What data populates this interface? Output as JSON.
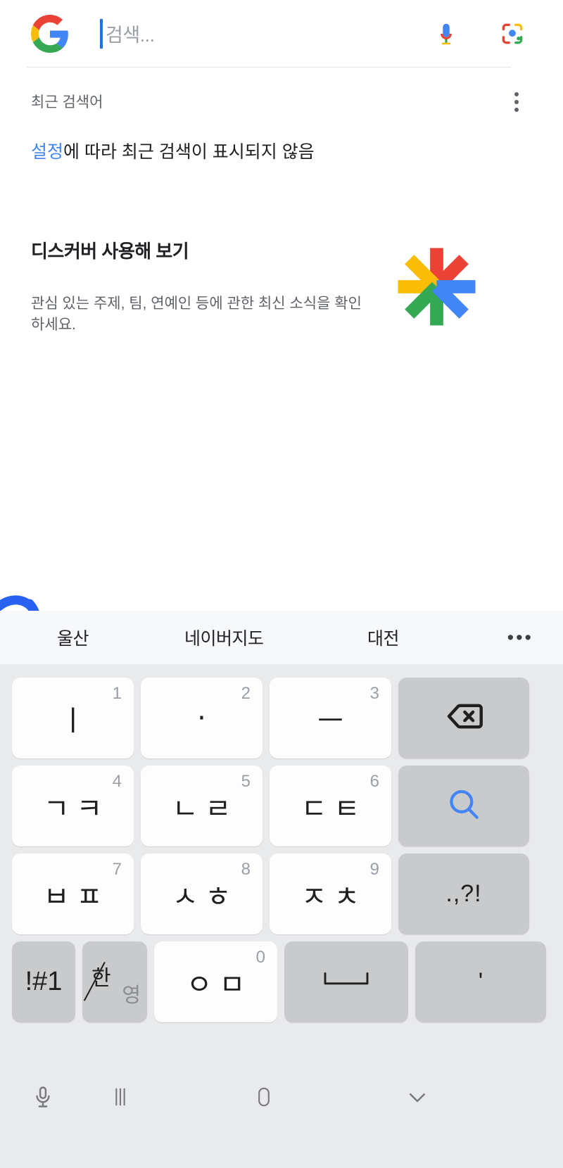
{
  "search": {
    "placeholder": "검색...",
    "value": "",
    "google_logo_icon": "google-g-logo",
    "mic_icon": "microphone-icon",
    "lens_icon": "google-lens-icon"
  },
  "recent": {
    "label": "최근 검색어",
    "overflow_icon": "more-vertical-icon",
    "notice_link": "설정",
    "notice_rest": "에 따라 최근 검색이 표시되지 않음"
  },
  "discover": {
    "title": "디스커버 사용해 보기",
    "subtitle": "관심 있는 주제, 팀, 연예인 등에 관한 최신 소식을 확인하세요.",
    "logo_icon": "google-discover-asterisk-icon"
  },
  "annotation": {
    "shape": "blue-circle-scribble",
    "color": "#2962f0"
  },
  "suggestions": {
    "items": [
      "울산",
      "네이버지도",
      "대전"
    ],
    "more_label": "•••"
  },
  "keyboard": {
    "rows": [
      [
        {
          "name": "key-i",
          "main": "ㅣ",
          "num": "1",
          "style": "white"
        },
        {
          "name": "key-dot",
          "main": "·",
          "num": "2",
          "style": "white"
        },
        {
          "name": "key-eu",
          "main": "ㅡ",
          "num": "3",
          "style": "white"
        },
        {
          "name": "key-backspace",
          "main": "",
          "num": "",
          "style": "grey",
          "icon": "backspace-icon"
        }
      ],
      [
        {
          "name": "key-giyeok-kieuk",
          "main": "ㄱㅋ",
          "num": "4",
          "style": "white"
        },
        {
          "name": "key-nieun-rieul",
          "main": "ㄴㄹ",
          "num": "5",
          "style": "white"
        },
        {
          "name": "key-digeut-tieut",
          "main": "ㄷㅌ",
          "num": "6",
          "style": "white"
        },
        {
          "name": "key-search",
          "main": "",
          "num": "",
          "style": "grey",
          "icon": "search-magnifier-icon"
        }
      ],
      [
        {
          "name": "key-bieup-pieup",
          "main": "ㅂㅍ",
          "num": "7",
          "style": "white"
        },
        {
          "name": "key-siot-hieut",
          "main": "ㅅㅎ",
          "num": "8",
          "style": "white"
        },
        {
          "name": "key-jieut-chieut",
          "main": "ㅈㅊ",
          "num": "9",
          "style": "white"
        },
        {
          "name": "key-punctuation",
          "main": ".,?!",
          "num": "",
          "style": "grey"
        }
      ]
    ],
    "bottom_row": {
      "symbols_label": "!#1",
      "lang_toggle_han": "한",
      "lang_toggle_eng": "영",
      "ieung_mieum": "ㅇㅁ",
      "ieung_mieum_num": "0",
      "space_icon": "space-bar-icon",
      "apostrophe": "'"
    }
  },
  "nav": {
    "mic_icon": "microphone-icon",
    "recents_icon": "recent-apps-icon",
    "home_icon": "home-icon",
    "hide_keyboard_icon": "chevron-down-icon"
  }
}
